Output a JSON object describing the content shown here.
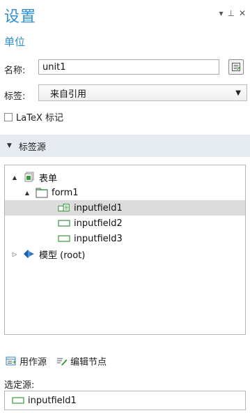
{
  "header": {
    "title": "设置",
    "subtitle": "单位",
    "controls": {
      "menu": "▾",
      "pin": "⊥",
      "close": "✕"
    }
  },
  "form": {
    "name_label": "名称:",
    "name_value": "unit1",
    "tag_label": "标签:",
    "tag_value": "来自引用",
    "latex_label": "LaTeX 标记",
    "latex_checked": false
  },
  "section": {
    "title": "标签源"
  },
  "tree": {
    "items": [
      {
        "label": "表单",
        "icon": "forms-icon",
        "expander": "▲",
        "level": 0
      },
      {
        "label": "form1",
        "icon": "folder-icon",
        "expander": "▲",
        "level": 1
      },
      {
        "label": "inputfield1",
        "icon": "inputfield-list-icon",
        "expander": "",
        "level": 2,
        "selected": true
      },
      {
        "label": "inputfield2",
        "icon": "inputfield-icon",
        "expander": "",
        "level": 2
      },
      {
        "label": "inputfield3",
        "icon": "inputfield-icon",
        "expander": "",
        "level": 2
      },
      {
        "label": "模型 (root)",
        "icon": "model-icon",
        "expander": "▷",
        "level": 0
      }
    ]
  },
  "toolbar": {
    "use_as_source": "用作源",
    "edit_node": "编辑节点"
  },
  "selected_source": {
    "label": "选定源:",
    "value": "inputfield1"
  },
  "colors": {
    "accent": "#2f8fd1",
    "section_bg": "#e6ebf1",
    "selected_row": "#dcdcdc",
    "field_icon": "#3b9a3b"
  }
}
